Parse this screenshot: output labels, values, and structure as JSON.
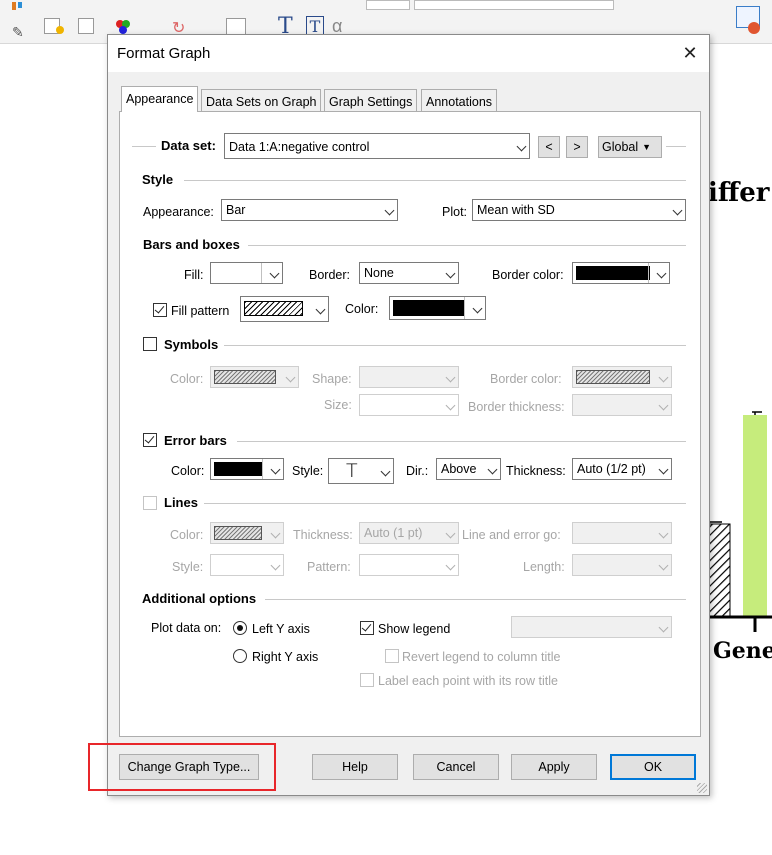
{
  "background": {
    "chart_title_fragment": "iffer",
    "x_label_fragment": "Gene",
    "bar_color": "#c6ec7c"
  },
  "dialog": {
    "title": "Format Graph",
    "tabs": [
      {
        "label": "Appearance",
        "active": true
      },
      {
        "label": "Data Sets on Graph",
        "active": false
      },
      {
        "label": "Graph Settings",
        "active": false
      },
      {
        "label": "Annotations",
        "active": false
      }
    ],
    "data_set": {
      "label": "Data set:",
      "value": "Data 1:A:negative control",
      "prev": "<",
      "next": ">",
      "global": "Global"
    },
    "style": {
      "header": "Style",
      "appearance_label": "Appearance:",
      "appearance_value": "Bar",
      "plot_label": "Plot:",
      "plot_value": "Mean with SD"
    },
    "bars": {
      "header": "Bars and boxes",
      "fill_label": "Fill:",
      "border_label": "Border:",
      "border_value": "None",
      "border_color_label": "Border color:",
      "fill_pattern_label": "Fill pattern",
      "fill_pattern_checked": true,
      "color_label": "Color:"
    },
    "symbols": {
      "header": "Symbols",
      "checked": false,
      "color_label": "Color:",
      "shape_label": "Shape:",
      "border_color_label": "Border color:",
      "size_label": "Size:",
      "border_thickness_label": "Border thickness:"
    },
    "error_bars": {
      "header": "Error bars",
      "checked": true,
      "color_label": "Color:",
      "style_label": "Style:",
      "style_value": "T",
      "dir_label": "Dir.:",
      "dir_value": "Above",
      "thickness_label": "Thickness:",
      "thickness_value": "Auto (1/2 pt)"
    },
    "lines": {
      "header": "Lines",
      "checked": false,
      "color_label": "Color:",
      "thickness_label": "Thickness:",
      "thickness_value": "Auto (1 pt)",
      "line_error_label": "Line and error go:",
      "style_label": "Style:",
      "pattern_label": "Pattern:",
      "length_label": "Length:"
    },
    "additional": {
      "header": "Additional options",
      "plot_on_label": "Plot data on:",
      "left_axis": "Left Y axis",
      "right_axis": "Right  Y axis",
      "left_selected": true,
      "show_legend": "Show legend",
      "show_legend_checked": true,
      "revert_legend": "Revert legend to column title",
      "label_points": "Label each point with its row title"
    },
    "buttons": {
      "change_type": "Change Graph Type...",
      "help": "Help",
      "cancel": "Cancel",
      "apply": "Apply",
      "ok": "OK"
    },
    "highlight_color": "#e8262a"
  }
}
